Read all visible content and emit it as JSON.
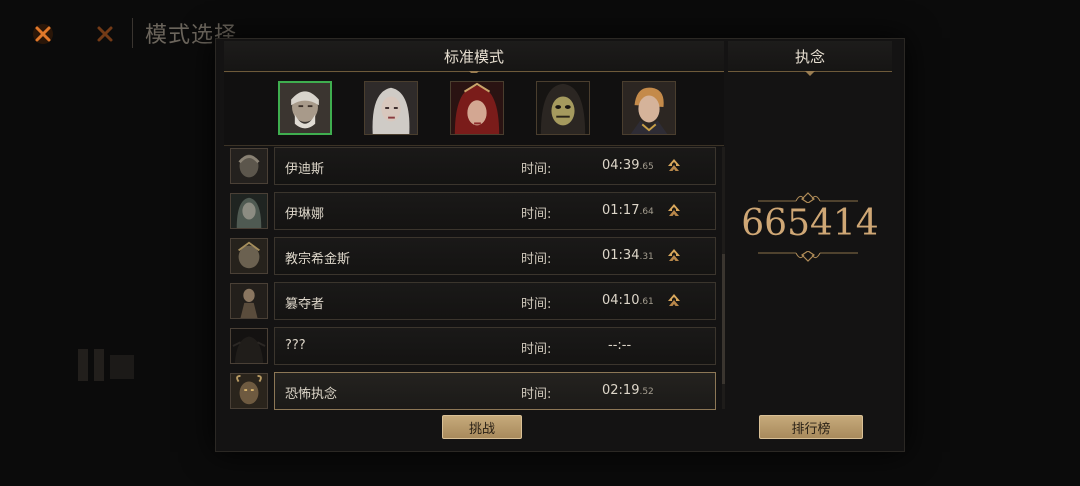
{
  "background": {
    "title": "模式选择"
  },
  "left_header": {
    "title": "标准模式"
  },
  "right_header": {
    "title": "执念"
  },
  "portraits": [
    {
      "name": "old-man",
      "selected": true
    },
    {
      "name": "white-hair-woman",
      "selected": false
    },
    {
      "name": "red-hood-woman",
      "selected": false
    },
    {
      "name": "masked-figure",
      "selected": false
    },
    {
      "name": "blond-man",
      "selected": false
    }
  ],
  "records": [
    {
      "name": "伊迪斯",
      "time_label": "时间:",
      "time_main": "04:39",
      "time_ms": ".65",
      "has_up": true
    },
    {
      "name": "伊琳娜",
      "time_label": "时间:",
      "time_main": "01:17",
      "time_ms": ".64",
      "has_up": true
    },
    {
      "name": "教宗希金斯",
      "time_label": "时间:",
      "time_main": "01:34",
      "time_ms": ".31",
      "has_up": true
    },
    {
      "name": "篡夺者",
      "time_label": "时间:",
      "time_main": "04:10",
      "time_ms": ".61",
      "has_up": true
    },
    {
      "name": "???",
      "time_label": "时间:",
      "time_main": "--:--",
      "time_ms": "",
      "has_up": false
    },
    {
      "name": "恐怖执念",
      "time_label": "时间:",
      "time_main": "02:19",
      "time_ms": ".52",
      "has_up": false
    }
  ],
  "buttons": {
    "challenge": "挑战",
    "leaderboard": "排行榜"
  },
  "score": "665414",
  "colors": {
    "accent_gold": "#cfa775",
    "selected_border": "#3fae4f",
    "button_gold": "#c6aa7b"
  }
}
